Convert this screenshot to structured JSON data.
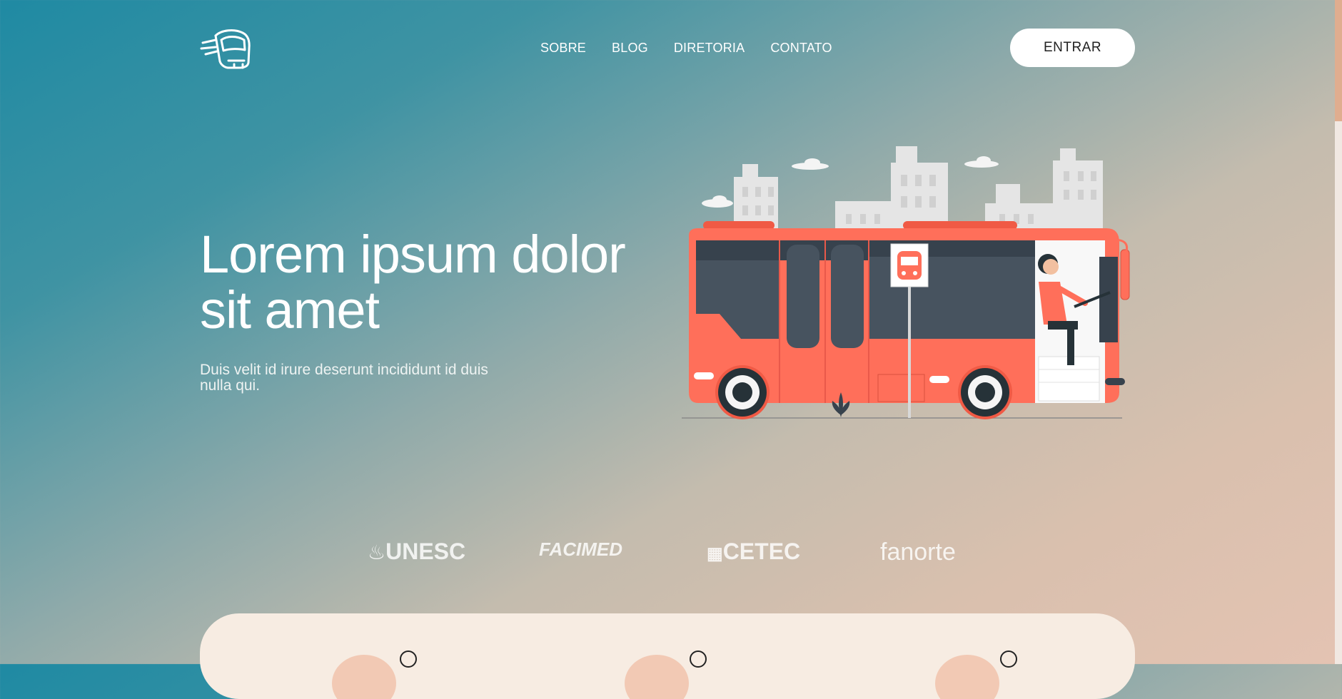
{
  "nav": {
    "items": [
      "SOBRE",
      "BLOG",
      "DIRETORIA",
      "CONTATO"
    ],
    "login_label": "ENTRAR"
  },
  "hero": {
    "title": "Lorem ipsum dolor sit amet",
    "subtitle": "Duis velit id irure deserunt incididunt id duis nulla qui."
  },
  "partners": [
    "UNESC",
    "FACIMED",
    "CETEC",
    "fanorte"
  ],
  "colors": {
    "bus_red": "#ff6f5a",
    "accent_peach": "#f2c9b4",
    "card_bg": "#f7ece2"
  },
  "icons": {
    "logo": "bus-logo-icon",
    "stop_sign": "bus-stop-icon"
  }
}
